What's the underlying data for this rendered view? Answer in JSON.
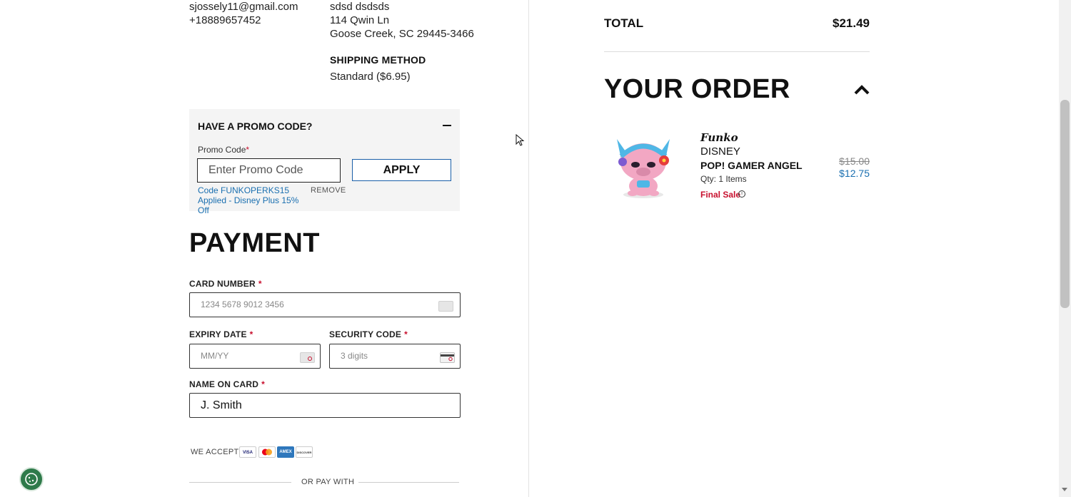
{
  "contact": {
    "email": "sjossely11@gmail.com",
    "phone": "+18889657452"
  },
  "address": {
    "name": "sdsd dsdsds",
    "street": "114 Qwin Ln",
    "city_line": "Goose Creek, SC 29445-3466"
  },
  "shipping": {
    "title": "SHIPPING METHOD",
    "value": "Standard ($6.95)"
  },
  "promo": {
    "title": "HAVE A PROMO CODE?",
    "label": "Promo Code",
    "required_mark": "*",
    "placeholder": "Enter Promo Code",
    "apply_label": "APPLY",
    "applied_text": "Code FUNKOPERKS15 Applied - Disney Plus 15% Off",
    "remove_label": "REMOVE"
  },
  "payment": {
    "title": "PAYMENT",
    "required_mark": "*",
    "card_number": {
      "label": "CARD NUMBER",
      "placeholder": "1234 5678 9012 3456"
    },
    "expiry": {
      "label": "EXPIRY DATE",
      "placeholder": "MM/YY"
    },
    "security": {
      "label": "SECURITY CODE",
      "placeholder": "3 digits"
    },
    "name_on_card": {
      "label": "NAME ON CARD",
      "value": "J. Smith"
    },
    "we_accept": "WE ACCEPT",
    "cards": [
      "VISA",
      "MC",
      "AMEX",
      "DISCOVER"
    ],
    "or_pay_with": "OR PAY WITH"
  },
  "summary": {
    "total_label": "TOTAL",
    "total_value": "$21.49",
    "order_title": "YOUR ORDER"
  },
  "order_item": {
    "brand_logo": "Funko",
    "brand": "DISNEY",
    "name": "POP! GAMER ANGEL",
    "qty": "Qty: 1 Items",
    "final_sale": "Final Sale",
    "info_glyph": "i",
    "price_old": "$15.00",
    "price_new": "$12.75"
  },
  "colors": {
    "accent_blue": "#1a6fb0",
    "sale_red": "#c8102e",
    "cookie_green": "#2e7a4a"
  }
}
